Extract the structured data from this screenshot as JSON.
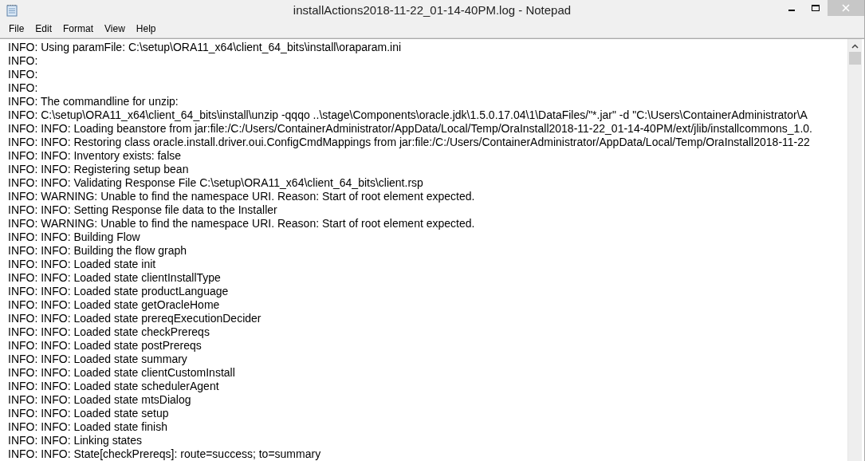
{
  "window": {
    "title": "installActions2018-11-22_01-14-40PM.log - Notepad"
  },
  "menu": [
    "File",
    "Edit",
    "Format",
    "View",
    "Help"
  ],
  "lines": [
    "INFO: Using paramFile: C:\\setup\\ORA11_x64\\client_64_bits\\install\\oraparam.ini",
    "INFO:",
    "INFO:",
    "INFO:",
    "INFO: The commandline for unzip:",
    "INFO: C:\\setup\\ORA11_x64\\client_64_bits\\install\\unzip -qqqo ..\\stage\\Components\\oracle.jdk\\1.5.0.17.04\\1\\DataFiles/\"*.jar\" -d \"C:\\Users\\ContainerAdministrator\\A",
    "INFO: INFO: Loading beanstore from jar:file:/C:/Users/ContainerAdministrator/AppData/Local/Temp/OraInstall2018-11-22_01-14-40PM/ext/jlib/installcommons_1.0.",
    "INFO: INFO: Restoring class oracle.install.driver.oui.ConfigCmdMappings from jar:file:/C:/Users/ContainerAdministrator/AppData/Local/Temp/OraInstall2018-11-22",
    "INFO: INFO: Inventory exists: false",
    "INFO: INFO: Registering setup bean",
    "INFO: INFO: Validating Response File C:\\setup\\ORA11_x64\\client_64_bits\\client.rsp",
    "INFO: WARNING: Unable to find the namespace URI. Reason: Start of root element expected.",
    "INFO: INFO: Setting Response file data to the Installer",
    "INFO: WARNING: Unable to find the namespace URI. Reason: Start of root element expected.",
    "INFO: INFO: Building Flow",
    "INFO: INFO: Building the flow graph",
    "INFO: INFO: Loaded state init",
    "INFO: INFO: Loaded state clientInstallType",
    "INFO: INFO: Loaded state productLanguage",
    "INFO: INFO: Loaded state getOracleHome",
    "INFO: INFO: Loaded state prereqExecutionDecider",
    "INFO: INFO: Loaded state checkPrereqs",
    "INFO: INFO: Loaded state postPrereqs",
    "INFO: INFO: Loaded state summary",
    "INFO: INFO: Loaded state clientCustomInstall",
    "INFO: INFO: Loaded state schedulerAgent",
    "INFO: INFO: Loaded state mtsDialog",
    "INFO: INFO: Loaded state setup",
    "INFO: INFO: Loaded state finish",
    "INFO: INFO: Linking states",
    "INFO: INFO: State[checkPrereqs]: route=success; to=summary"
  ]
}
